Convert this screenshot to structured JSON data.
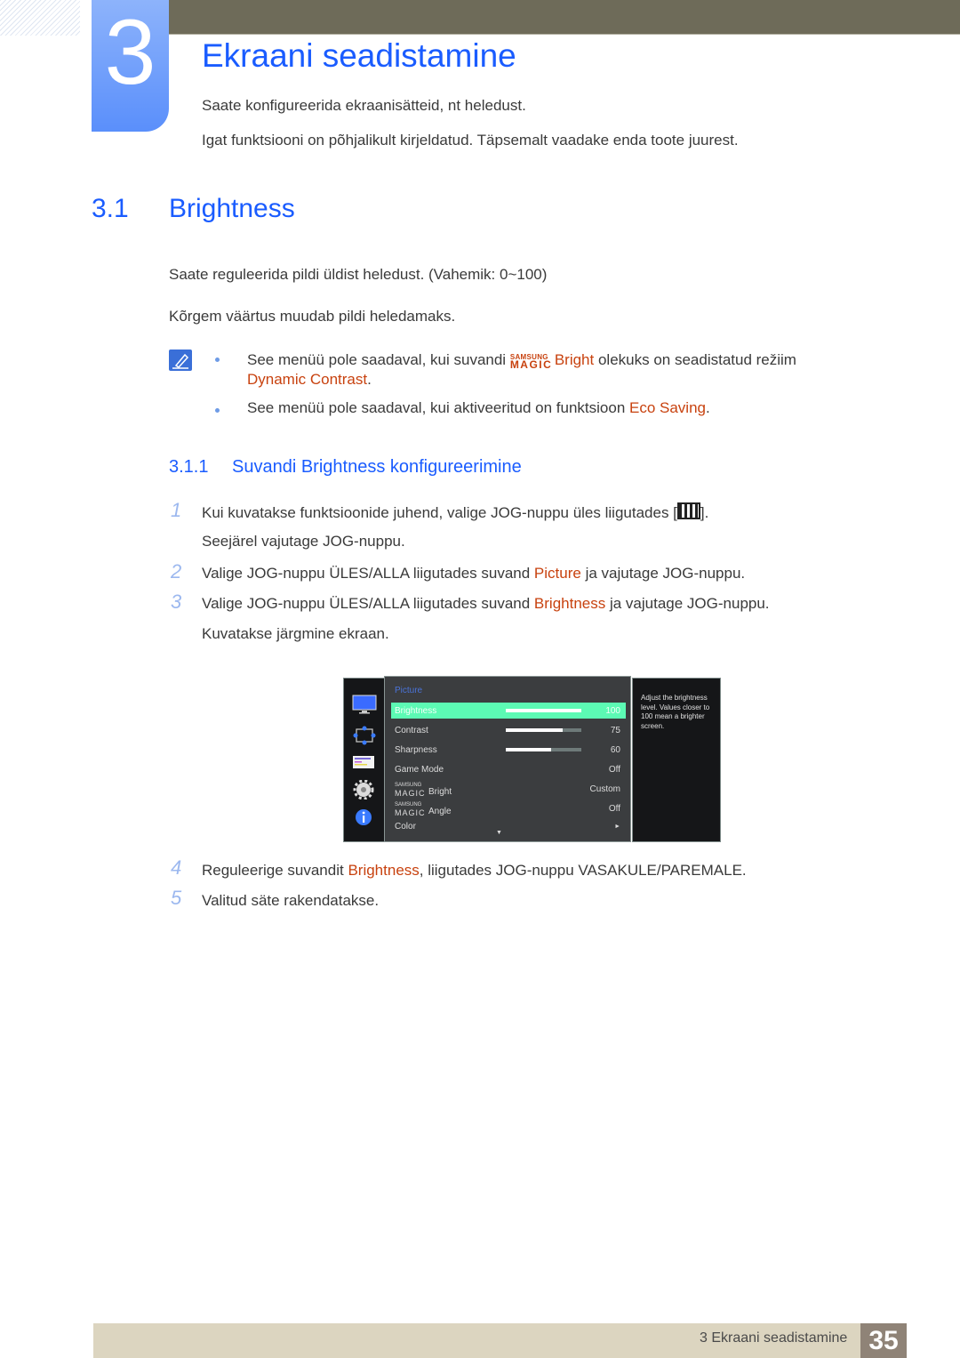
{
  "chapter": {
    "number": "3",
    "title": "Ekraani seadistamine",
    "intro": [
      "Saate konfigureerida ekraanisätteid, nt heledust.",
      "Igat funktsiooni on põhjalikult kirjeldatud. Täpsemalt vaadake enda toote juurest."
    ]
  },
  "section": {
    "number": "3.1",
    "title": "Brightness",
    "paragraphs": [
      "Saate reguleerida pildi üldist heledust. (Vahemik: 0~100)",
      "Kõrgem väärtus muudab pildi heledamaks."
    ],
    "notes": {
      "icon": "note-pencil-icon",
      "note1_before": "See menüü pole saadaval, kui suvandi ",
      "note1_magic_top": "SAMSUNG",
      "note1_magic_bottom": "MAGIC",
      "note1_highlight": "Bright",
      "note1_after": " olekuks on seadistatud režiim",
      "note1_line2_highlight": "Dynamic Contrast",
      "note1_line2_after": ".",
      "note2_before": "See menüü pole saadaval, kui aktiveeritud on funktsioon ",
      "note2_highlight": "Eco Saving",
      "note2_after": "."
    }
  },
  "subsection": {
    "number": "3.1.1",
    "title": "Suvandi Brightness konfigureerimine",
    "steps": [
      {
        "num": "1",
        "before": "Kui kuvatakse funktsioonide juhend, valige JOG-nuppu üles liigutades [",
        "icon": "menu-icon",
        "after": "].",
        "line2": "Seejärel vajutage JOG-nuppu."
      },
      {
        "num": "2",
        "before": "Valige JOG-nuppu ÜLES/ALLA liigutades suvand ",
        "highlight": "Picture",
        "after": " ja vajutage JOG-nuppu."
      },
      {
        "num": "3",
        "before": "Valige JOG-nuppu ÜLES/ALLA liigutades suvand ",
        "highlight": "Brightness",
        "after": " ja vajutage JOG-nuppu.",
        "line2": "Kuvatakse järgmine ekraan."
      },
      {
        "num": "4",
        "before": "Reguleerige suvandit ",
        "highlight": "Brightness",
        "after": ", liigutades JOG-nuppu VASAKULE/PAREMALE."
      },
      {
        "num": "5",
        "before": "Valitud säte rakendatakse."
      }
    ]
  },
  "osd": {
    "sidebar_icons": [
      "picture-monitor-icon",
      "onscreen-display-icon",
      "system-icon",
      "settings-gear-icon",
      "information-icon"
    ],
    "title": "Picture",
    "rows": [
      {
        "label": "Brightness",
        "value": "100",
        "level": 100,
        "selected": true
      },
      {
        "label": "Contrast",
        "value": "75",
        "level": 75
      },
      {
        "label": "Sharpness",
        "value": "60",
        "level": 60
      },
      {
        "label": "Game Mode",
        "value": "Off"
      },
      {
        "label": "Bright",
        "magic_top": "SAMSUNG",
        "magic_bottom": "MAGIC",
        "value": "Custom"
      },
      {
        "label": "Angle",
        "magic_top": "SAMSUNG",
        "magic_bottom": "MAGIC",
        "value": "Off"
      },
      {
        "label": "Color",
        "value": "►"
      }
    ],
    "scroll_down": "▼",
    "help_text": "Adjust the brightness level. Values closer to 100 mean a brighter screen."
  },
  "footer": {
    "chapter_label": "3 Ekraani seadistamine",
    "page_number": "35"
  },
  "colors": {
    "accent_blue": "#1a5cff",
    "highlight_orange": "#c8420f",
    "osd_selected": "#5cfab4"
  }
}
